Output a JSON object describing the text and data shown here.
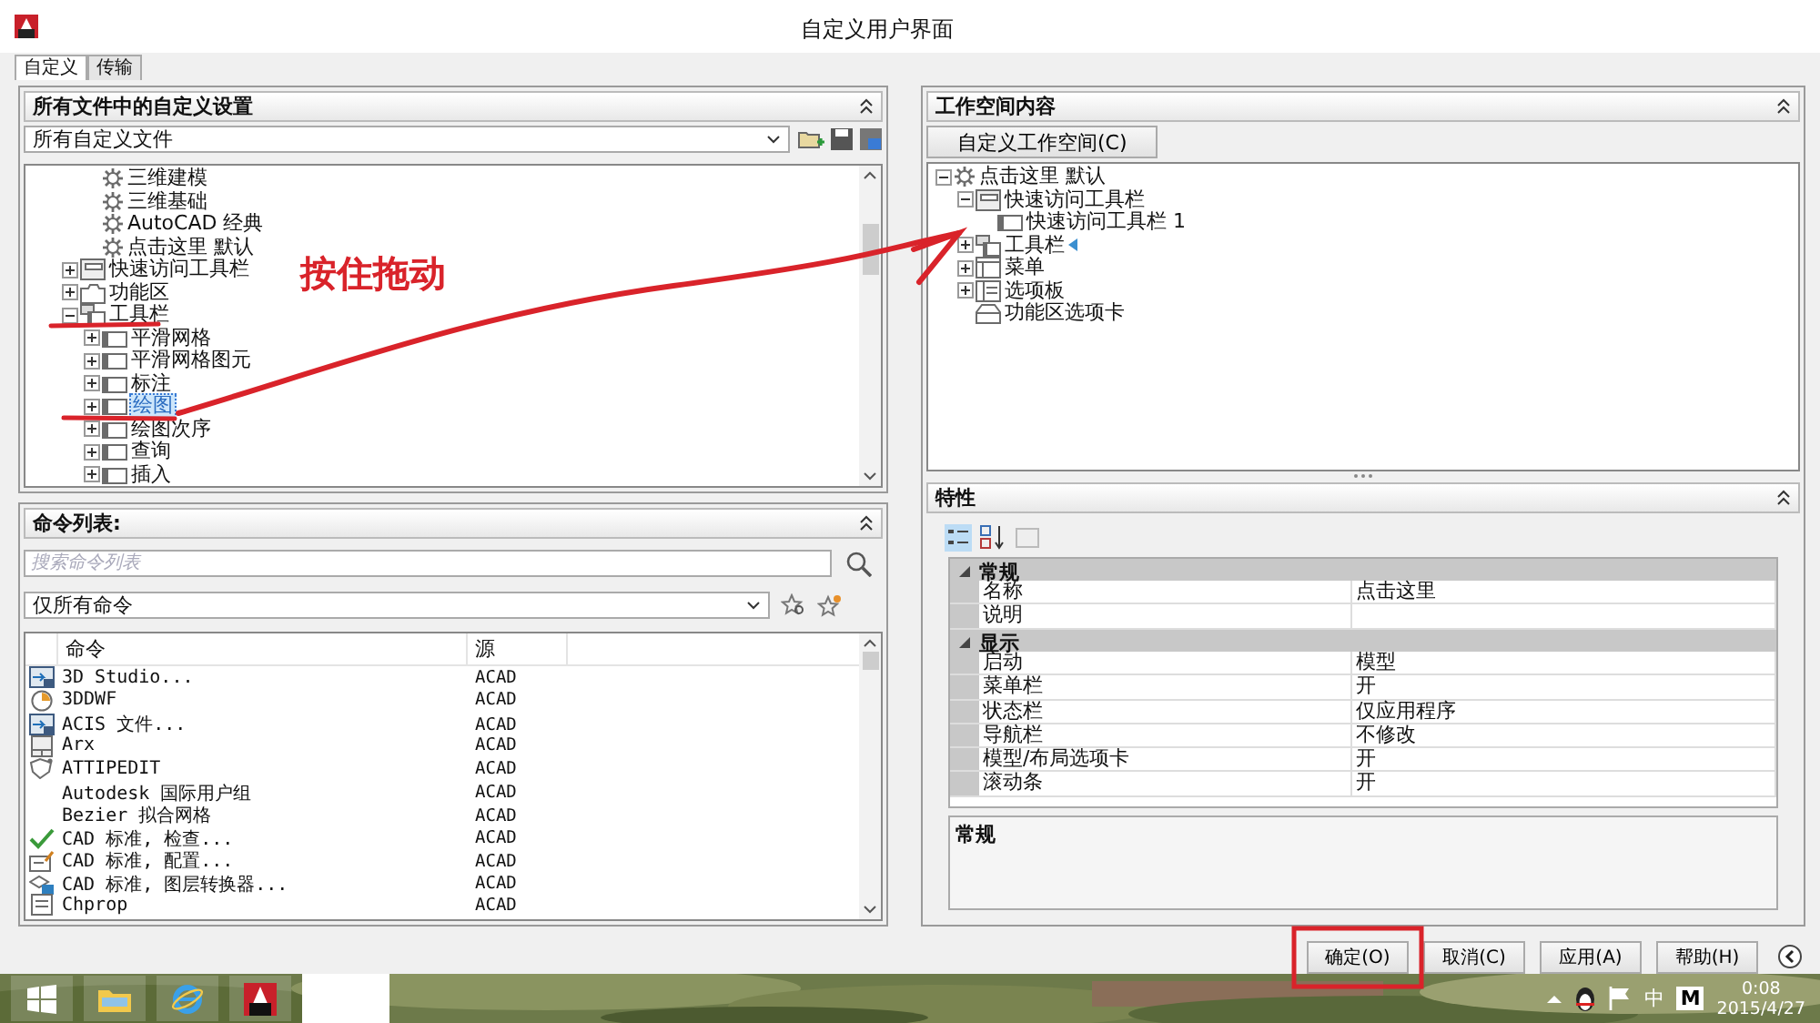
{
  "window": {
    "title": "自定义用户界面"
  },
  "tabs": [
    {
      "label": "自定义",
      "selected": true
    },
    {
      "label": "传输",
      "selected": false
    }
  ],
  "customizations": {
    "title": "所有文件中的自定义设置",
    "file_select": "所有自定义文件",
    "tree": [
      {
        "children": [
          {
            "kind": "gear",
            "label": "三维建模",
            "selected": false
          },
          {
            "kind": "gear",
            "label": "三维基础",
            "selected": false
          },
          {
            "kind": "gear",
            "label": "AutoCAD 经典",
            "selected": false
          },
          {
            "kind": "gear",
            "label": "点击这里 默认",
            "selected": false
          }
        ]
      },
      {
        "kind": "quick",
        "label": "快速访问工具栏",
        "selected": false,
        "expanded": false
      },
      {
        "kind": "ribbon",
        "label": "功能区",
        "selected": false,
        "expanded": false
      },
      {
        "kind": "toolbar",
        "label": "工具栏",
        "selected": false,
        "expanded": true,
        "children": [
          {
            "kind": "bar",
            "label": "平滑网格",
            "selected": false,
            "expanded": false
          },
          {
            "kind": "bar",
            "label": "平滑网格图元",
            "selected": false,
            "expanded": false
          },
          {
            "kind": "bar",
            "label": "标注",
            "selected": false,
            "expanded": false
          },
          {
            "kind": "bar",
            "label": "绘图",
            "selected": true,
            "expanded": false
          },
          {
            "kind": "bar",
            "label": "绘图次序",
            "selected": false,
            "expanded": false
          },
          {
            "kind": "bar",
            "label": "查询",
            "selected": false,
            "expanded": false
          },
          {
            "kind": "bar",
            "label": "插入",
            "selected": false,
            "expanded": false
          }
        ]
      }
    ]
  },
  "command_list": {
    "title": "命令列表:",
    "search": {
      "placeholder": "搜索命令列表"
    },
    "filter": "仅所有命令",
    "columns": [
      "命令",
      "源"
    ],
    "rows": [
      {
        "kind": "import",
        "command": "3D Studio...",
        "source": "ACAD"
      },
      {
        "kind": "disc",
        "command": "3DDWF",
        "source": "ACAD"
      },
      {
        "kind": "import",
        "command": "ACIS 文件...",
        "source": "ACAD"
      },
      {
        "kind": "grid",
        "command": "Arx",
        "source": "ACAD"
      },
      {
        "kind": "shield",
        "command": "ATTIPEDIT",
        "source": "ACAD"
      },
      {
        "kind": "none",
        "command": "Autodesk 国际用户组",
        "source": "ACAD"
      },
      {
        "kind": "none",
        "command": "Bezier 拟合网格",
        "source": "ACAD"
      },
      {
        "kind": "check",
        "command": "CAD 标准, 检查...",
        "source": "ACAD"
      },
      {
        "kind": "form",
        "command": "CAD 标准, 配置...",
        "source": "ACAD"
      },
      {
        "kind": "layers",
        "command": "CAD 标准, 图层转换器...",
        "source": "ACAD"
      },
      {
        "kind": "list",
        "command": "Chprop",
        "source": "ACAD"
      }
    ]
  },
  "workspace_contents": {
    "title": "工作空间内容",
    "button": "自定义工作空间(C)",
    "tree": [
      {
        "kind": "gear",
        "label": "点击这里 默认",
        "selected": false,
        "expanded": true,
        "children": [
          {
            "kind": "quick",
            "label": "快速访问工具栏",
            "selected": false,
            "expanded": true,
            "children": [
              {
                "kind": "bar",
                "label": "快速访问工具栏 1",
                "selected": false
              }
            ]
          },
          {
            "kind": "toolbar",
            "label": "工具栏",
            "selected": false,
            "expanded": false,
            "drop_marker": true
          },
          {
            "kind": "menu",
            "label": "菜单",
            "selected": false,
            "expanded": false
          },
          {
            "kind": "palette",
            "label": "选项板",
            "selected": false,
            "expanded": false
          },
          {
            "kind": "tab",
            "label": "功能区选项卡",
            "selected": false
          }
        ]
      }
    ]
  },
  "properties": {
    "title": "特性",
    "sections": [
      {
        "name": "常规",
        "rows": [
          {
            "name": "名称",
            "value": "点击这里"
          },
          {
            "name": "说明"
          }
        ]
      },
      {
        "name": "显示",
        "rows": [
          {
            "name": "启动",
            "value": "模型"
          },
          {
            "name": "菜单栏",
            "value": "开"
          },
          {
            "name": "状态栏",
            "value": "仅应用程序"
          },
          {
            "name": "导航栏",
            "value": "不修改"
          },
          {
            "name": "模型/布局选项卡",
            "value": "开"
          },
          {
            "name": "滚动条",
            "value": "开"
          }
        ]
      }
    ],
    "description_title": "常规"
  },
  "buttons": [
    {
      "label": "确定(O)"
    },
    {
      "label": "取消(C)"
    },
    {
      "label": "应用(A)"
    },
    {
      "label": "帮助(H)"
    }
  ],
  "annotation": {
    "text": "按住拖动"
  },
  "taskbar": {
    "ime": "中",
    "tray_letter": "M",
    "time": "0:08",
    "date": "2015/4/27"
  }
}
